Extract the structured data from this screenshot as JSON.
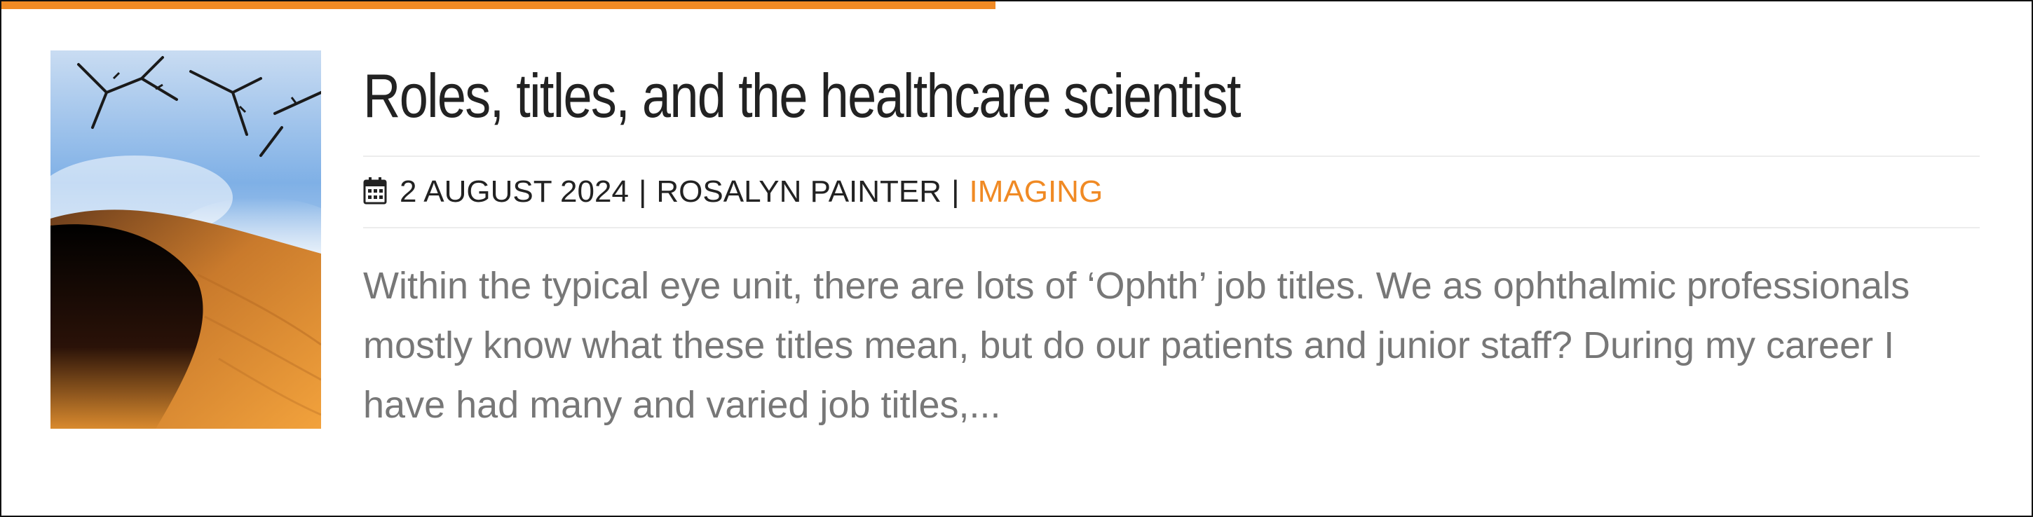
{
  "post": {
    "title": "Roles, titles, and the healthcare scientist",
    "date": "2 AUGUST 2024",
    "separator": "|",
    "author": "ROSALYN PAINTER",
    "category": "IMAGING",
    "excerpt": "Within the typical eye unit, there are lots of ‘Ophth’ job titles. We as ophthalmic professionals mostly know what these titles mean, but do our patients and junior staff? During my career I have had many and varied job titles,...",
    "thumbnail_icon": "desert-sky-thumbnail",
    "date_icon": "calendar-icon"
  },
  "colors": {
    "accent": "#f08a24",
    "title": "#222222",
    "meta": "#222222",
    "excerpt": "#777777",
    "border": "#111111"
  }
}
